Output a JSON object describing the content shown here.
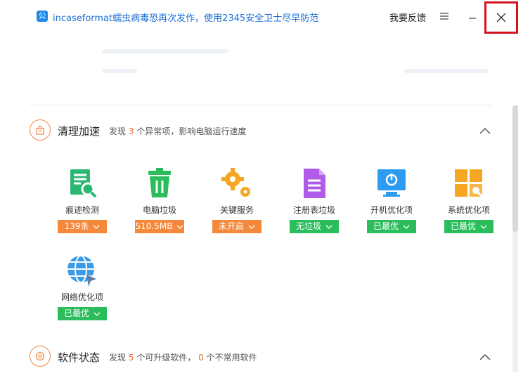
{
  "header": {
    "logo_glyph": "公",
    "title": "incaseformat蠕虫病毒恐再次发作，使用2345安全卫士尽早防范",
    "feedback_label": "我要反馈",
    "menu_icon": "hamburger-icon",
    "minimize_icon": "minimize-icon",
    "close_icon": "close-icon"
  },
  "colors": {
    "accent_blue": "#1a6fd6",
    "orange": "#f5893b",
    "green": "#2bbd5c",
    "close_highlight": "#d4141c"
  },
  "clean_section": {
    "title": "清理加速",
    "desc_pre": "发现",
    "count": "3",
    "desc_post": "个异常项，影响电脑运行速度",
    "items": [
      {
        "label": "痕迹检测",
        "badge": "139条",
        "status": "orange",
        "icon": "trace-scan-icon"
      },
      {
        "label": "电脑垃圾",
        "badge": "510.5MB",
        "status": "orange",
        "icon": "trash-bin-icon"
      },
      {
        "label": "关键服务",
        "badge": "未开启",
        "status": "orange",
        "icon": "gears-icon"
      },
      {
        "label": "注册表垃圾",
        "badge": "无垃圾",
        "status": "green",
        "icon": "registry-doc-icon"
      },
      {
        "label": "开机优化项",
        "badge": "已最优",
        "status": "green",
        "icon": "power-monitor-icon"
      },
      {
        "label": "系统优化项",
        "badge": "已最优",
        "status": "green",
        "icon": "windows-tools-icon"
      },
      {
        "label": "网络优化项",
        "badge": "已最优",
        "status": "green",
        "icon": "network-globe-icon"
      }
    ]
  },
  "software_section": {
    "title": "软件状态",
    "desc_pre": "发现",
    "count1": "5",
    "desc_mid": "个可升级软件，",
    "count2": "0",
    "desc_post": "个不常用软件"
  }
}
